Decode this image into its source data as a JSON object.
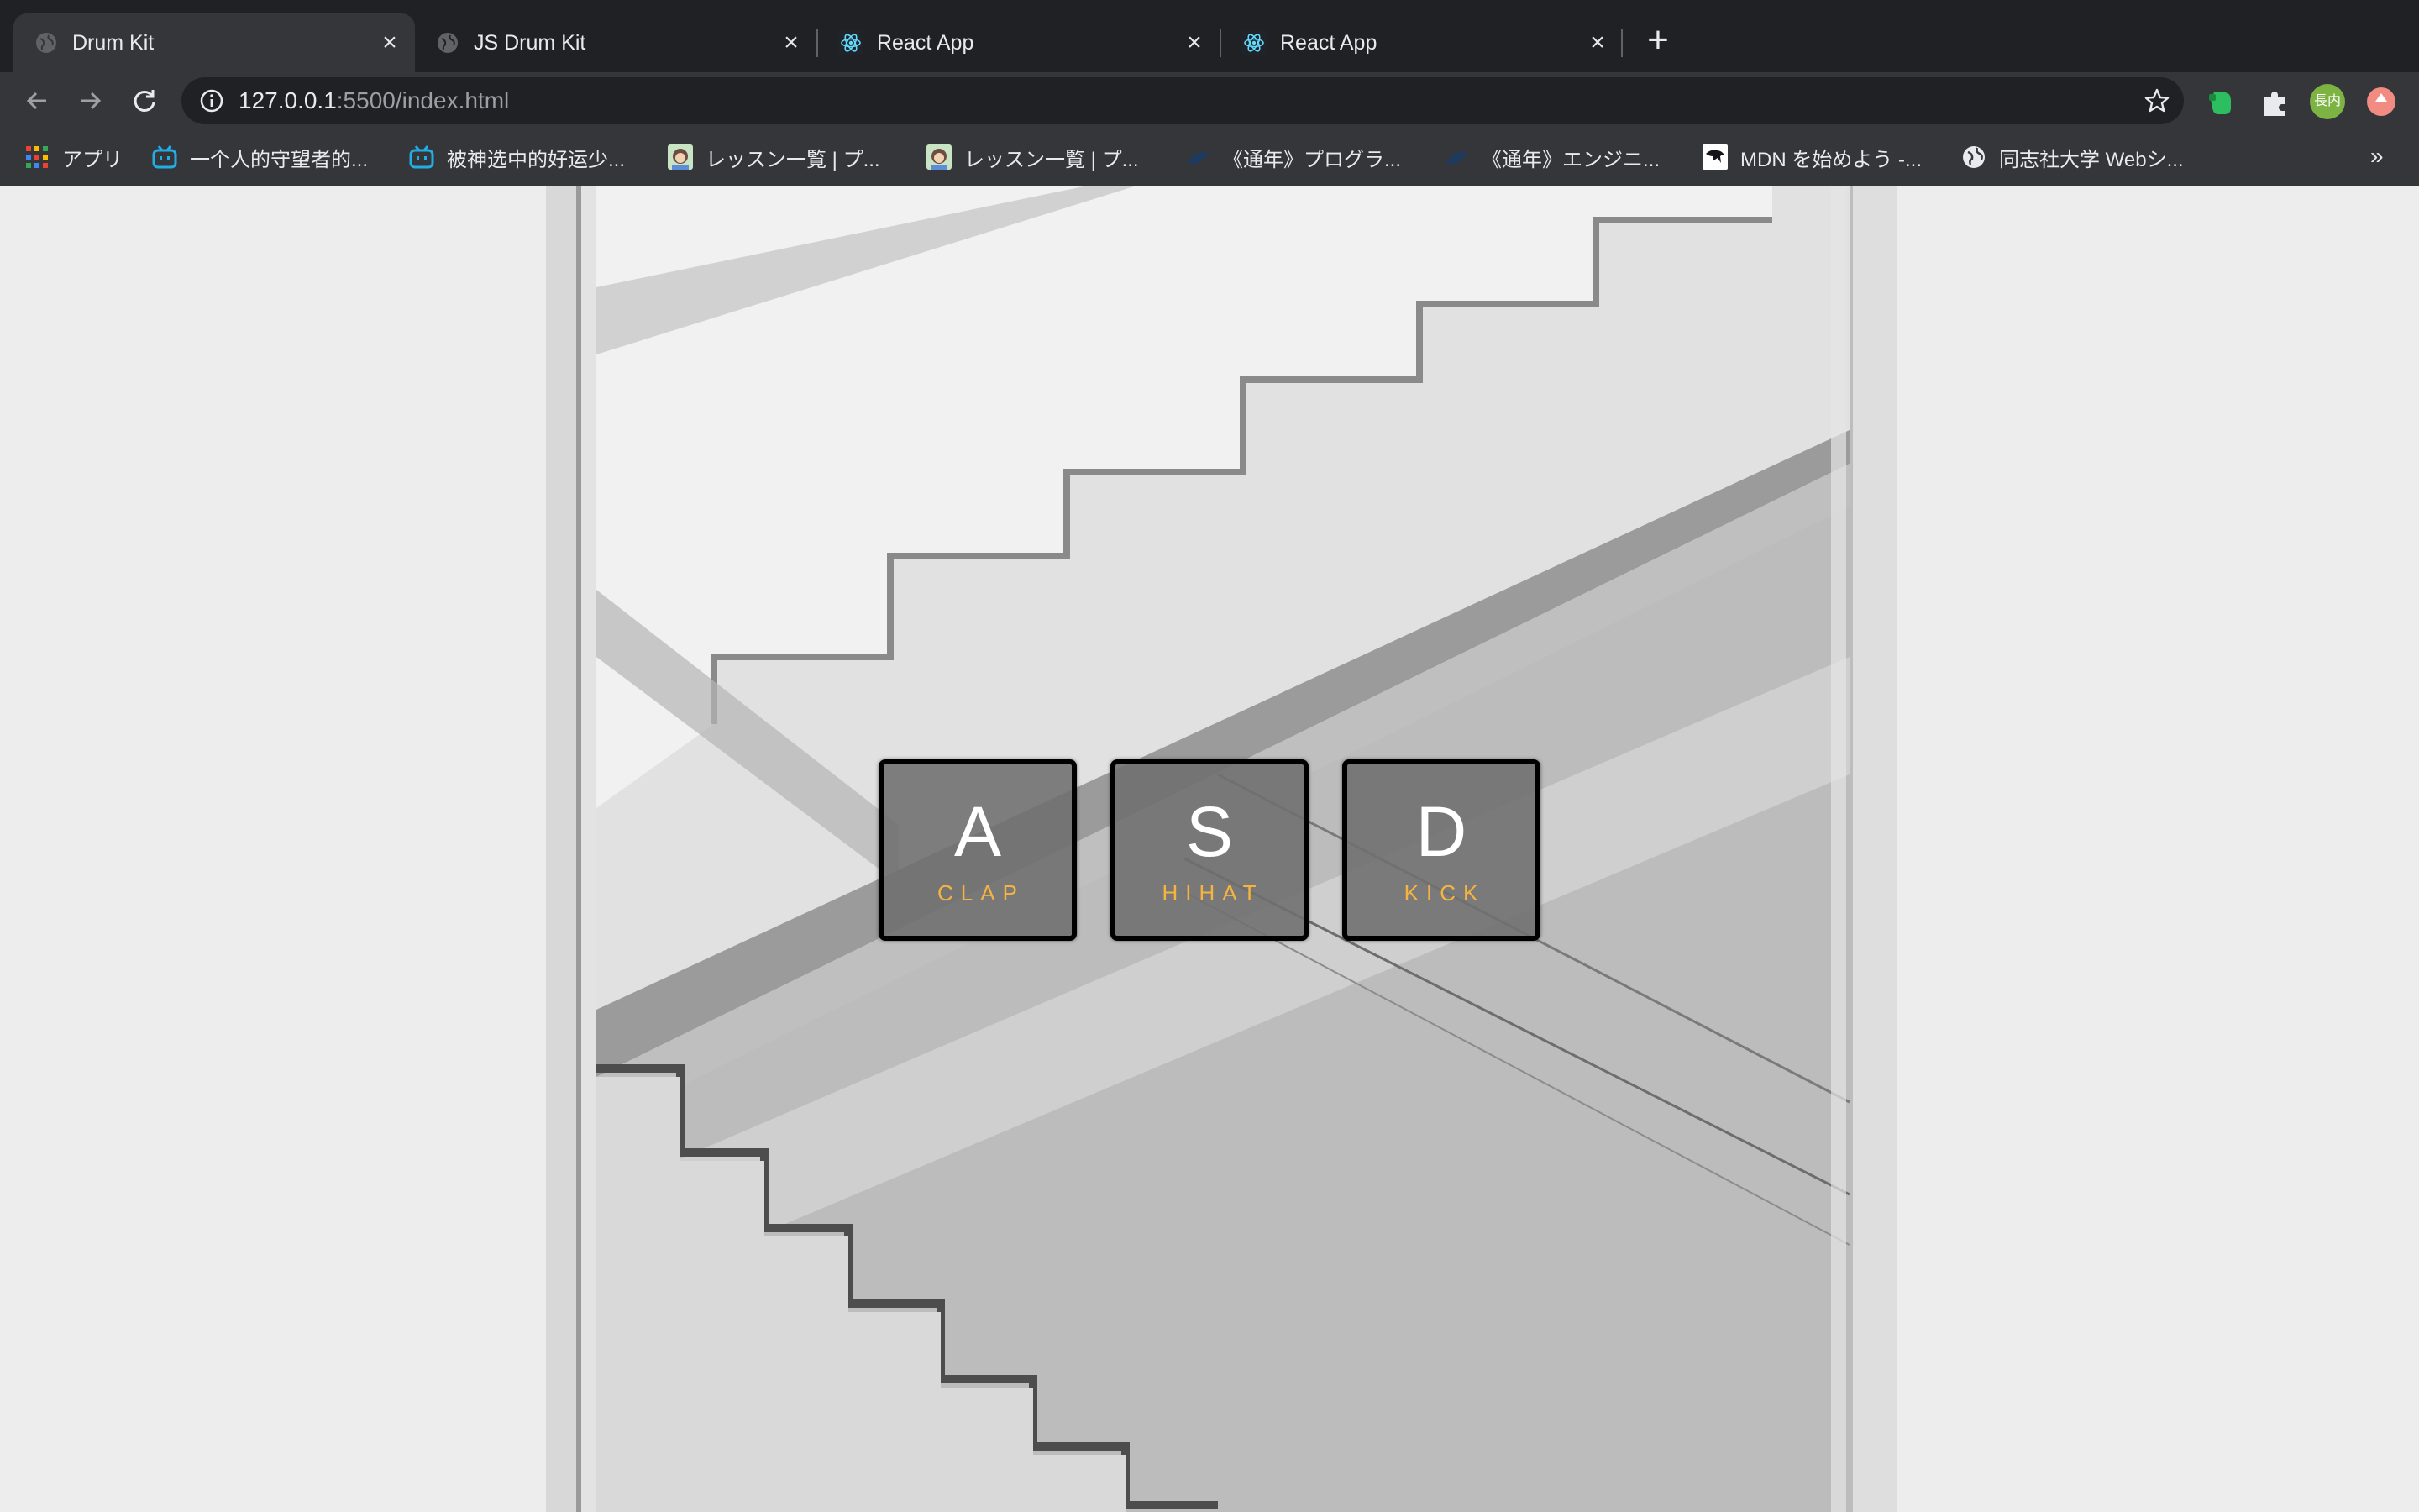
{
  "browser": {
    "tabs": [
      {
        "title": "Drum Kit",
        "active": true,
        "favicon": "globe-icon"
      },
      {
        "title": "JS Drum Kit",
        "active": false,
        "favicon": "globe-icon"
      },
      {
        "title": "React App",
        "active": false,
        "favicon": "react-icon"
      },
      {
        "title": "React App",
        "active": false,
        "favicon": "react-icon"
      }
    ],
    "new_tab_label": "+",
    "address": {
      "host": "127.0.0.1",
      "rest": ":5500/index.html"
    },
    "profile_initials": "長内",
    "bookmarks": [
      {
        "label": "アプリ",
        "icon": "apps-grid-icon"
      },
      {
        "label": "一个人的守望者的...",
        "icon": "bilibili-icon"
      },
      {
        "label": "被神选中的好运少...",
        "icon": "bilibili-icon"
      },
      {
        "label": "レッスン一覧 | プ...",
        "icon": "progate-icon"
      },
      {
        "label": "レッスン一覧 | プ...",
        "icon": "progate-icon"
      },
      {
        "label": "《通年》プログラ...",
        "icon": "bird-icon"
      },
      {
        "label": "《通年》エンジニ...",
        "icon": "bird-icon"
      },
      {
        "label": "MDN を始めよう -...",
        "icon": "mdn-icon"
      },
      {
        "label": "同志社大学 Webシ...",
        "icon": "globe-icon"
      }
    ],
    "bookmarks_more": "»"
  },
  "drumkit": {
    "keys": [
      {
        "key": "A",
        "sound": "CLAP"
      },
      {
        "key": "S",
        "sound": "HIHAT"
      },
      {
        "key": "D",
        "sound": "KICK"
      }
    ]
  },
  "colors": {
    "key_label": "#f5b440",
    "key_border": "#000000",
    "page_bg": "#ededed"
  }
}
